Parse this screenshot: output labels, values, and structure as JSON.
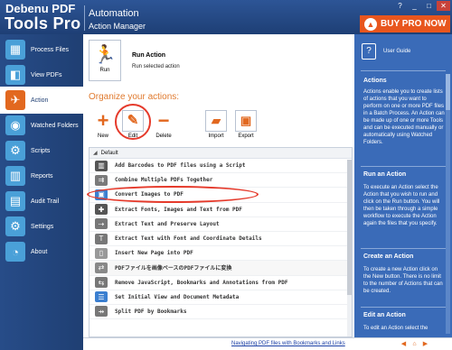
{
  "app": {
    "brand_line1": "Debenu PDF",
    "brand_line2": "Tools Pro",
    "section_title": "Automation",
    "section_subtitle": "Action Manager",
    "upgrade_label": "BUY PRO NOW"
  },
  "window_controls": [
    "?",
    "_",
    "□",
    "✕"
  ],
  "sidebar": {
    "items": [
      {
        "label": "Process Files",
        "icon": "process-files-icon",
        "color": "#4aa0d8",
        "glyph": "▦",
        "active": false
      },
      {
        "label": "View PDFs",
        "icon": "view-pdfs-icon",
        "color": "#4aa0d8",
        "glyph": "◧",
        "active": false
      },
      {
        "label": "Action",
        "icon": "action-runner-icon",
        "color": "#e2681f",
        "glyph": "✈",
        "active": true
      },
      {
        "label": "Watched Folders",
        "icon": "watched-folders-icon",
        "color": "#4aa0d8",
        "glyph": "◉",
        "active": false
      },
      {
        "label": "Scripts",
        "icon": "scripts-icon",
        "color": "#4aa0d8",
        "glyph": "⚙",
        "active": false
      },
      {
        "label": "Reports",
        "icon": "reports-icon",
        "color": "#4aa0d8",
        "glyph": "▥",
        "active": false
      },
      {
        "label": "Audit Trail",
        "icon": "audit-trail-icon",
        "color": "#4aa0d8",
        "glyph": "▤",
        "active": false
      },
      {
        "label": "Settings",
        "icon": "settings-icon",
        "color": "#4aa0d8",
        "glyph": "⚙",
        "active": false
      },
      {
        "label": "About",
        "icon": "about-icon",
        "color": "#4aa0d8",
        "glyph": "◔",
        "active": false
      }
    ]
  },
  "run": {
    "button_label": "Run",
    "title": "Run Action",
    "subtitle": "Run selected action"
  },
  "organize_label": "Organize your actions:",
  "toolbar": {
    "new_label": "New",
    "edit_label": "Edit",
    "delete_label": "Delete",
    "import_label": "Import",
    "export_label": "Export"
  },
  "actions": {
    "group_label": "Default",
    "items": [
      {
        "label": "Add Barcodes to PDF files using a Script",
        "icon": "barcode-icon",
        "color": "#555555",
        "glyph": "▥"
      },
      {
        "label": "Combine Multiple PDFs Together",
        "icon": "combine-icon",
        "color": "#7a7a7a",
        "glyph": "⇉"
      },
      {
        "label": "Convert Images to PDF",
        "icon": "image-icon",
        "color": "#3b7fd0",
        "glyph": "▣"
      },
      {
        "label": "Extract Fonts, Images and Text from PDF",
        "icon": "extract-icon",
        "color": "#555555",
        "glyph": "✚"
      },
      {
        "label": "Extract Text and Preserve Layout",
        "icon": "text-layout-icon",
        "color": "#777777",
        "glyph": "⇢"
      },
      {
        "label": "Extract Text with Font and Coordinate Details",
        "icon": "text-font-icon",
        "color": "#777777",
        "glyph": "T"
      },
      {
        "label": "Insert New Page into PDF",
        "icon": "insert-page-icon",
        "color": "#999999",
        "glyph": "▯"
      },
      {
        "label": "PDFファイルを画像ベースのPDFファイルに変換",
        "icon": "convert-image-pdf-icon",
        "color": "#888888",
        "glyph": "⇄"
      },
      {
        "label": "Remove JavaScript, Bookmarks and Annotations from PDF",
        "icon": "remove-icon",
        "color": "#777777",
        "glyph": "⇆"
      },
      {
        "label": "Set Initial View and Document Metadata",
        "icon": "metadata-icon",
        "color": "#3b7fd0",
        "glyph": "☰"
      },
      {
        "label": "Split PDF by Bookmarks",
        "icon": "split-icon",
        "color": "#777777",
        "glyph": "⇸"
      }
    ]
  },
  "guide": {
    "label": "User Guide",
    "sections": [
      {
        "heading": "Actions",
        "body": "Actions enable you to create lists of actions that you want to perform on one or more PDF files in a Batch Process. An Action can be made up of one or more Tools and can be executed manually or automatically using Watched Folders."
      },
      {
        "heading": "Run an Action",
        "body": "To execute an Action select the Action that you wish to run and click on the Run button. You will then be taken through a simple workflow to execute the Action again the files that you specify."
      },
      {
        "heading": "Create an Action",
        "body": "To create a new Action click on the New button. There is no limit to the number of Actions that can be created."
      },
      {
        "heading": "Edit an Action",
        "body": "To edit an Action select the"
      }
    ]
  },
  "status": {
    "link_text": "Navigating PDF files with Bookmarks and Links"
  }
}
